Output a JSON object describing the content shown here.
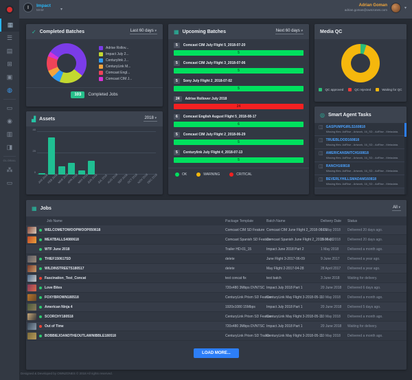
{
  "topbar": {
    "brand": "Impact",
    "brand_sub": "MAM",
    "brand_initial": "I",
    "user_name": "Adrian Goman",
    "user_email": "adrian.goman@ownzones.com"
  },
  "sidebar": {
    "items": [
      {
        "name": "dashboard",
        "icon": "▦",
        "active": true
      },
      {
        "name": "batches",
        "icon": "☰"
      },
      {
        "name": "storage",
        "icon": "▤"
      },
      {
        "name": "packages",
        "icon": "⊞"
      },
      {
        "name": "calendar",
        "icon": "▣"
      },
      {
        "name": "web",
        "icon": "◍",
        "accent": true
      },
      {
        "name": "divider"
      },
      {
        "name": "monitor",
        "icon": "▭"
      },
      {
        "name": "review",
        "icon": "◉"
      },
      {
        "name": "library",
        "icon": "▥"
      },
      {
        "name": "media",
        "icon": "◨"
      },
      {
        "name": "divider"
      },
      {
        "name": "label",
        "text": "GLOBAL"
      },
      {
        "name": "network",
        "icon": "⁂"
      },
      {
        "name": "screens",
        "icon": "▭"
      }
    ]
  },
  "panels": {
    "completed": {
      "title": "Completed Batches",
      "range": "Last 60 days",
      "count": "103",
      "count_label": "Completed Jobs"
    },
    "upcoming": {
      "title": "Upcoming Batches",
      "range": "Next 60 days",
      "items": [
        {
          "count": "5",
          "name": "Comcast CIM July Flight 5_2018-07-20",
          "status": "ok"
        },
        {
          "count": "5",
          "name": "Comcast CIM July Flight 3_2018-07-06",
          "status": "ok"
        },
        {
          "count": "5",
          "name": "Sony July Flight 2_2018-07-02",
          "status": "ok"
        },
        {
          "count": "24",
          "name": "Adrise Rollover July 2018",
          "status": "critical"
        },
        {
          "count": "6",
          "name": "Comcast English August Flight 5_2018-08-17",
          "status": "ok"
        },
        {
          "count": "5",
          "name": "Comcast CIM July Flight 2_2018-06-29",
          "status": "ok"
        },
        {
          "count": "5",
          "name": "Centurylink July Flight 4_2018-07-13",
          "status": "ok"
        }
      ],
      "status_colors": {
        "ok": "#00e05e",
        "critical": "#f32121"
      },
      "legend": [
        {
          "label": "OK",
          "color": "#00e05e"
        },
        {
          "label": "WARNING",
          "color": "#f5b70d"
        },
        {
          "label": "CRITICAL",
          "color": "#f32121"
        }
      ]
    },
    "media_qc": {
      "title": "Media QC"
    },
    "assets": {
      "title": "Assets",
      "range": "2018"
    },
    "smart": {
      "title": "Smart Agent Tasks",
      "items": [
        {
          "title": "GASPUMPGIRLS160818",
          "subtitle": "Missing files: AdRise - Artwork, 16_SD - AdRise - Metadata."
        },
        {
          "title": "TRUEBLOOD160818",
          "subtitle": "Missing files: AdRise - Artwork, 16_SD - AdRise - Metadata."
        },
        {
          "title": "AMERICANSNITCH160818",
          "subtitle": "Missing files: AdRise - Artwork, 16_SD - AdRise - Metadata."
        },
        {
          "title": "RANCH160818",
          "subtitle": "Missing files: AdRise - Artwork, 16_SD - AdRise - Metadata."
        },
        {
          "title": "BEVERLYHILLSMADAM160818",
          "subtitle": "Missing files: AdRise - Artwork, 16_SD - AdRise - Metadata."
        }
      ]
    },
    "jobs": {
      "title": "Jobs",
      "filter": "All",
      "columns": [
        "Job Name",
        "Package Template",
        "Batch Name",
        "Delivery Date",
        "Status"
      ],
      "dot_colors": {
        "ok": "#2ecc71",
        "waiting": "#f44336"
      },
      "rows": [
        {
          "name": "WELCOMETOWOOPWOOP050618",
          "dot": "ok",
          "package": "Comcast CIM SD Feature",
          "batch": "Comcast CIM June Flight 2_2018-06-01",
          "date": "31 May 2018",
          "status": "Delivered 20 days ago.",
          "thumb": [
            "#8a4a3a",
            "#d8c9b8"
          ]
        },
        {
          "name": "MEATBALLS4080618",
          "dot": "ok",
          "package": "Comcast Spanish SD Feature",
          "batch": "Comcast Spanish June Flight 2_2018-06-01",
          "date": "31 May 2018",
          "status": "Delivered 20 days ago.",
          "thumb": [
            "#c24a2a",
            "#e8a03a"
          ]
        },
        {
          "name": "WTF June 2018",
          "dot": "ok",
          "package": "Trailer HD-01_15",
          "batch": "Impact June 2018 Part 2",
          "date": "1 May 2018",
          "status": "Delivered a month ago.",
          "thumb": null
        },
        {
          "name": "THIEF150617SD",
          "dot": "ok",
          "package": "delete",
          "batch": "June Flight 3-2017-06-09",
          "date": "9 June 2017",
          "status": "Delivered a year ago.",
          "thumb": [
            "#5a5a62",
            "#9a8a7a"
          ]
        },
        {
          "name": "WILDINSTREETS180517",
          "dot": "ok",
          "package": "delete",
          "batch": "May Flight 2-2017-04-28",
          "date": "28 April 2017",
          "status": "Delivered a year ago.",
          "thumb": [
            "#7a3a2a",
            "#c89a6a"
          ]
        },
        {
          "name": "Fascination_Test_Concat",
          "dot": "waiting",
          "package": "test concat fix",
          "batch": "test batch",
          "date": "3 June 2018",
          "status": "Waiting for delivery.",
          "thumb": [
            "#4a6a8a",
            "#c8c8c8"
          ]
        },
        {
          "name": "Love Bites",
          "dot": "ok",
          "package": "720x480 3Mbps DVNTSC",
          "batch": "Impact July 2018 Part 1",
          "date": "20 June 2018",
          "status": "Delivered 6 days ago.",
          "thumb": [
            "#8a3a5a",
            "#d86a4a"
          ]
        },
        {
          "name": "FOXYBROWN180518",
          "dot": "ok",
          "package": "CenturyLink Prism SD Feature",
          "batch": "CenturyLink May Flight 3-2018-05-11",
          "date": "10 May 2018",
          "status": "Delivered a month ago.",
          "thumb": [
            "#b8742a",
            "#6a4a2a"
          ]
        },
        {
          "name": "American Ninja 4",
          "dot": "ok",
          "package": "1920x1080 15Mbps",
          "batch": "Impact July 2018 Part 1",
          "date": "20 June 2018",
          "status": "Delivered 5 days ago.",
          "thumb": [
            "#4a5a3a",
            "#8a7a5a"
          ]
        },
        {
          "name": "SCORCHY180518",
          "dot": "ok",
          "package": "CenturyLink Prism SD Feature",
          "batch": "CenturyLink May Flight 3-2018-05-11",
          "date": "10 May 2018",
          "status": "Delivered a month ago.",
          "thumb": [
            "#c8a878",
            "#3a3a3a"
          ]
        },
        {
          "name": "Out of Time",
          "dot": "waiting",
          "package": "720x480 3Mbps DVNTSC",
          "batch": "Impact July 2018 Part 1",
          "date": "20 June 2018",
          "status": "Waiting for delivery.",
          "thumb": [
            "#3a4a5a",
            "#8a9aaa"
          ]
        },
        {
          "name": "BOBBIEJOANDTHEOUTLAWNIBBLE180518",
          "dot": "ok",
          "package": "CenturyLink Prism SD Trailer",
          "batch": "CenturyLink May Flight 3-2018-05-11",
          "date": "10 May 2018",
          "status": "Delivered a month ago.",
          "thumb": [
            "#7a6a3a",
            "#b89a5a"
          ]
        }
      ],
      "load_more": "LOAD MORE..."
    }
  },
  "footer": {
    "text": "Designed & Developed by OWNZONES © 2018 All rights reserved."
  },
  "chart_data": [
    {
      "id": "completed_batches",
      "type": "pie",
      "title": "Completed Batches",
      "labels": [
        "Adrise Rollov...",
        "Impact July 2...",
        "Centurylink J...",
        "CenturyLink M...",
        "Comcast Engl...",
        "Comcast CIM J..."
      ],
      "values": [
        51,
        20,
        7,
        6,
        12,
        4
      ],
      "colors": [
        "#7b3ce8",
        "#c3d830",
        "#2e9af0",
        "#f2a33c",
        "#f04358",
        "#d633d6"
      ],
      "units": "percent of 103 completed jobs (estimated from arc angles)",
      "start_angle": -55,
      "legend_position": "right",
      "center_total": 103,
      "center_total_label": "Completed Jobs"
    },
    {
      "id": "media_qc",
      "type": "pie",
      "title": "Media QC",
      "labels": [
        "QC approved",
        "QC rejected",
        "Waiting for QC"
      ],
      "values": [
        5,
        0,
        95
      ],
      "colors": [
        "#2dbd78",
        "#f03a3a",
        "#f5b70d"
      ],
      "units": "percent (estimated from arc angles)",
      "start_angle": 0,
      "legend_position": "bottom"
    },
    {
      "id": "assets",
      "type": "bar",
      "title": "Assets",
      "year_filter": "2018",
      "categories": [
        "JAN 2018",
        "FEB 2018",
        "MAR 2018",
        "APR 2018",
        "MAY 2018",
        "JUN 2018",
        "JUL 2018",
        "AUG 2018",
        "SEP 2018",
        "OCT 2018",
        "NOV 2018",
        "DEC 2018"
      ],
      "values": [
        1,
        35,
        8,
        11,
        4,
        13,
        0,
        0,
        0,
        0,
        0,
        0
      ],
      "color": "#1fbf92",
      "xlabel": "",
      "ylabel": "",
      "ylim": [
        0,
        40
      ],
      "yticks": [
        0,
        20,
        40
      ],
      "grid": true
    }
  ]
}
